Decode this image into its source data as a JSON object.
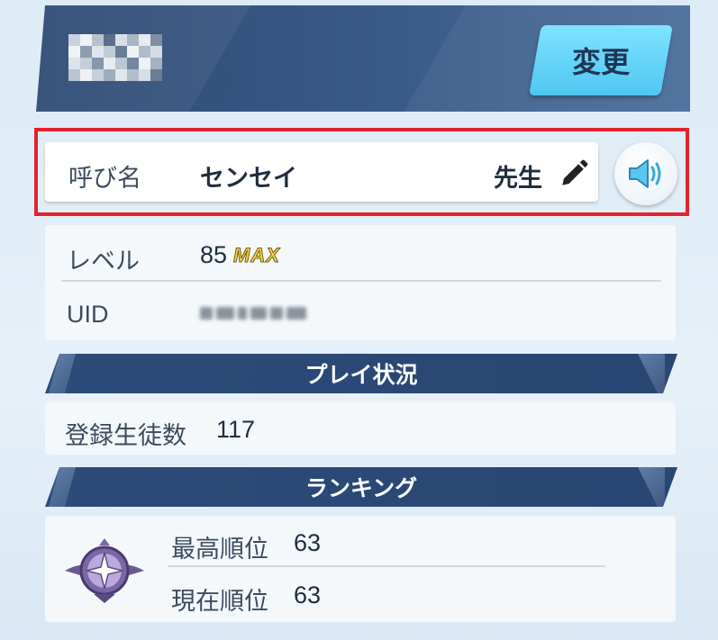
{
  "header": {
    "change_button_label": "変更"
  },
  "nickname": {
    "label": "呼び名",
    "value": "センセイ",
    "suffix": "先生"
  },
  "profile": {
    "level_label": "レベル",
    "level_value": "85",
    "level_badge": "MAX",
    "uid_label": "UID"
  },
  "play_status": {
    "title": "プレイ状況",
    "students_label": "登録生徒数",
    "students_value": "117"
  },
  "ranking": {
    "title": "ランキング",
    "best_label": "最高順位",
    "best_value": "63",
    "current_label": "現在順位",
    "current_value": "63"
  },
  "colors": {
    "highlight": "#e0242f",
    "banner": "#2c4b78",
    "accent_button": "#4fc7f1"
  },
  "icons": {
    "edit": "pencil-icon",
    "voice": "speaker-icon",
    "rank": "rank-emblem-icon"
  }
}
